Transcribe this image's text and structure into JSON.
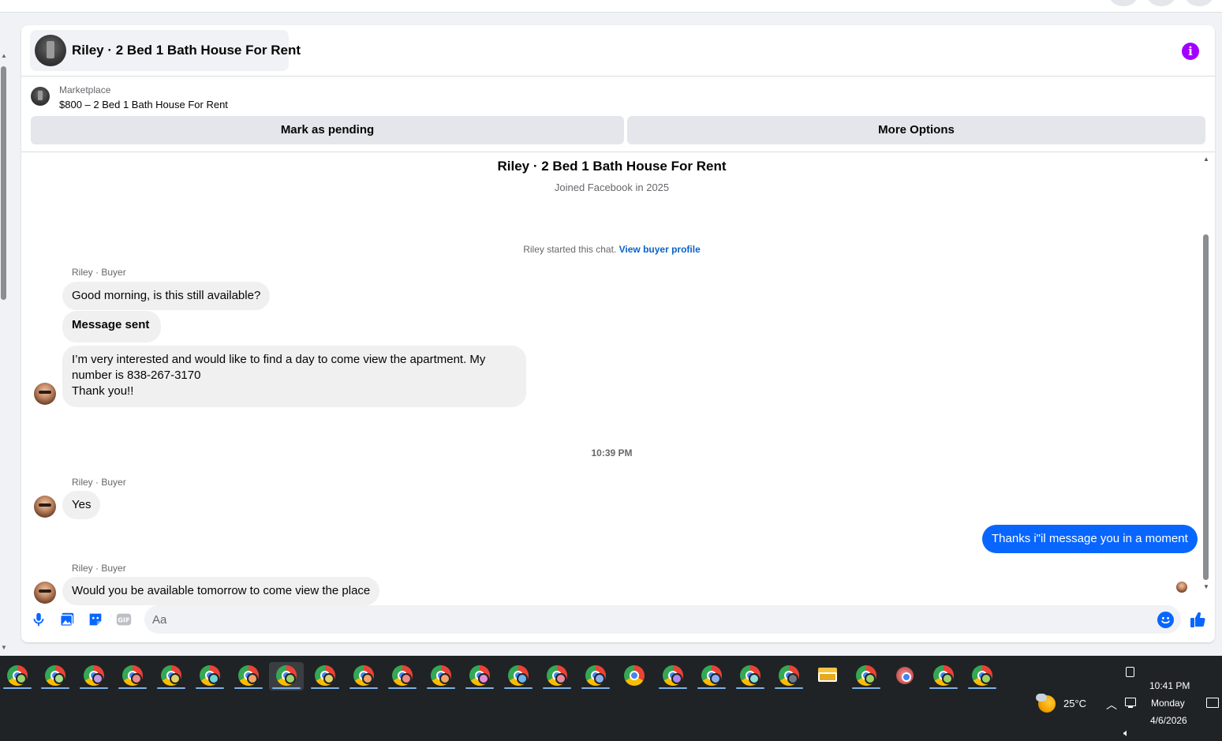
{
  "chat": {
    "header_title": "Riley · 2 Bed 1 Bath House For Rent",
    "listing_label": "Marketplace",
    "listing_title": "$800 – 2 Bed 1 Bath House For Rent",
    "mark_pending_label": "Mark as pending",
    "more_options_label": "More Options"
  },
  "intro": {
    "name": "Riley · 2 Bed 1 Bath House For Rent",
    "joined": "Joined Facebook in 2025",
    "started_text": "Riley started this chat.",
    "view_profile_link": "View buyer profile"
  },
  "messages": {
    "sender_1": "Riley · Buyer",
    "msg_1": "Good morning, is this still available?",
    "msg_2": "Message sent",
    "msg_3_line1": "I’m very interested and would like to find a day to come view the apartment. My",
    "msg_3_line2": "number is 838-267-3170",
    "msg_3_line3": "Thank you!!",
    "timestamp": "10:39 PM",
    "sender_2": "Riley · Buyer",
    "msg_4": "Yes",
    "msg_out": "Thanks i\"il message you in a moment",
    "sender_3": "Riley · Buyer",
    "msg_5": "Would you be available tomorrow to come view the place"
  },
  "composer": {
    "placeholder": "Aa",
    "icons": [
      "microphone-icon",
      "photo-icon",
      "sticker-icon",
      "gif-icon",
      "emoji-icon",
      "thumbs-up-icon"
    ]
  },
  "taskbar": {
    "badge_colors": [
      "#9bd36b",
      "#a6e08a",
      "#c59ae8",
      "#f08a8a",
      "#e0d26b",
      "#6bd4d8",
      "#f0a56b",
      "#9bd36b",
      "#e0d26b",
      "#f0a56b",
      "#f08a8a",
      "#f0a56b",
      "#e88ad6",
      "#6bb4f0",
      "#e88a9b",
      "#8ab0f0",
      "#8ab0f0",
      "#a98af0",
      "#8ab0f0",
      "#8ae0d6",
      "#6b7b8a",
      "#9bd36b",
      "#9bd36b"
    ],
    "weather_temp": "25°C",
    "clock_time": "10:41 PM",
    "clock_day": "Monday",
    "clock_date": "4/6/2026"
  },
  "colors": {
    "accent": "#0866ff",
    "info": "#a100ff",
    "link": "#0a62c9",
    "incoming_bubble": "#f0f0f0"
  }
}
